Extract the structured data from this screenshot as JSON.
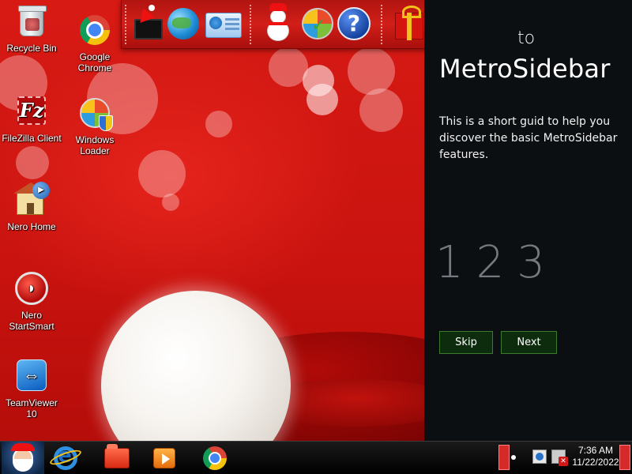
{
  "desktop": {
    "icons": [
      {
        "label": "Recycle Bin",
        "icon": "recycle-bin-icon"
      },
      {
        "label": "Google Chrome",
        "icon": "chrome-icon"
      },
      {
        "label": "FileZilla Client",
        "icon": "filezilla-icon"
      },
      {
        "label": "Windows Loader",
        "icon": "windows-loader-icon"
      },
      {
        "label": "Nero Home",
        "icon": "nero-home-icon"
      },
      {
        "label": "Nero StartSmart",
        "icon": "nero-startsmart-icon"
      },
      {
        "label": "TeamViewer 10",
        "icon": "teamviewer-icon"
      }
    ]
  },
  "dock": {
    "items": [
      "computer-santa-hat-icon",
      "network-globe-icon",
      "control-panel-icon",
      "snowman-icon",
      "windows-update-icon",
      "help-icon",
      "gift-icon",
      "folder-icon",
      "recycle-bin-icon"
    ]
  },
  "sidebar": {
    "to_text": "to",
    "title": "MetroSidebar",
    "description": "This is a short guid to help you discover the basic MetroSidebar features.",
    "steps": [
      "1",
      "2",
      "3"
    ],
    "skip_label": "Skip",
    "next_label": "Next",
    "button_border_color": "#3c7a2e",
    "background_color": "#0b0f12"
  },
  "taskbar": {
    "pinned": [
      "santa-start-icon",
      "internet-explorer-icon",
      "file-explorer-icon",
      "media-player-icon",
      "chrome-icon"
    ],
    "clock_time": "7:36 AM",
    "clock_date": "11/22/2022"
  }
}
